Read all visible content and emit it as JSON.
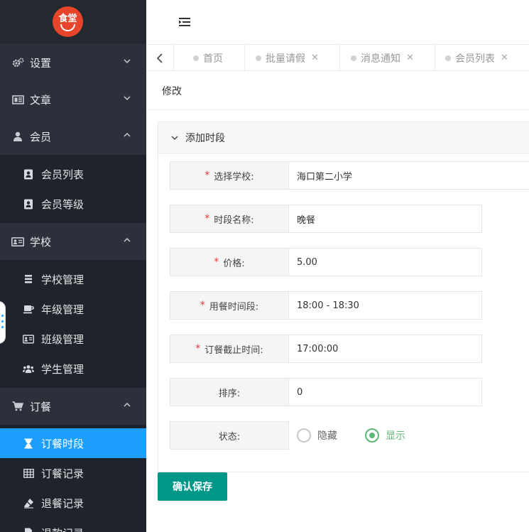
{
  "logo": {
    "text": "食堂"
  },
  "sidebar": {
    "groups": [
      {
        "label": "设置",
        "icon": "gears-icon",
        "expanded": false
      },
      {
        "label": "文章",
        "icon": "newspaper-icon",
        "expanded": false
      },
      {
        "label": "会员",
        "icon": "user-icon",
        "expanded": true,
        "items": [
          {
            "label": "会员列表",
            "icon": "address-book-icon"
          },
          {
            "label": "会员等级",
            "icon": "address-book-icon"
          }
        ]
      },
      {
        "label": "学校",
        "icon": "id-card-icon",
        "expanded": true,
        "items": [
          {
            "label": "学校管理",
            "icon": "list-icon"
          },
          {
            "label": "年级管理",
            "icon": "coffee-icon"
          },
          {
            "label": "班级管理",
            "icon": "id-card-icon"
          },
          {
            "label": "学生管理",
            "icon": "users-icon"
          }
        ]
      },
      {
        "label": "订餐",
        "icon": "cart-icon",
        "expanded": true,
        "items": [
          {
            "label": "订餐时段",
            "icon": "hourglass-icon",
            "active": true
          },
          {
            "label": "订餐记录",
            "icon": "table-icon"
          },
          {
            "label": "退餐记录",
            "icon": "eraser-icon"
          },
          {
            "label": "退款记录",
            "icon": "file-icon"
          }
        ]
      }
    ]
  },
  "tabs": [
    {
      "label": "首页",
      "closable": false
    },
    {
      "label": "批量请假",
      "closable": true
    },
    {
      "label": "消息通知",
      "closable": true
    },
    {
      "label": "会员列表",
      "closable": true
    }
  ],
  "page": {
    "title": "修改"
  },
  "form": {
    "section_title": "添加时段",
    "fields": [
      {
        "label": "选择学校:",
        "required": true,
        "value": "海口第二小学"
      },
      {
        "label": "时段名称:",
        "required": true,
        "value": "晚餐"
      },
      {
        "label": "价格:",
        "required": true,
        "value": "5.00"
      },
      {
        "label": "用餐时间段:",
        "required": true,
        "value": "18:00 - 18:30"
      },
      {
        "label": "订餐截止时间:",
        "required": true,
        "value": "17:00:00"
      },
      {
        "label": "排序:",
        "required": false,
        "value": "0"
      }
    ],
    "status": {
      "label": "状态:",
      "options": [
        {
          "label": "隐藏",
          "selected": false
        },
        {
          "label": "显示",
          "selected": true
        }
      ]
    },
    "save_label": "确认保存"
  },
  "colors": {
    "sidebar_bg": "#2b303b",
    "active": "#1e9fff",
    "primary_button": "#009688",
    "radio_on": "#5fb878",
    "required": "#e53935"
  }
}
